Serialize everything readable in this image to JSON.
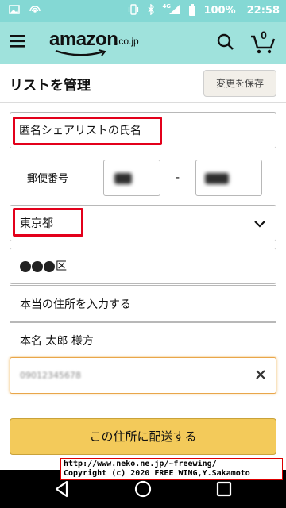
{
  "status_bar": {
    "battery_text": "100%",
    "time": "22:58",
    "network": "4G"
  },
  "header": {
    "logo_text": "amazon",
    "logo_suffix": ".co.jp",
    "cart_count": "0"
  },
  "page": {
    "title": "リストを管理",
    "save_button": "変更を保存"
  },
  "form": {
    "name_value": "匿名シェアリストの氏名",
    "postal_label": "郵便番号",
    "postal_separator": "-",
    "prefecture_value": "東京都",
    "city_suffix": "区",
    "address_value": "本当の住所を入力する",
    "recipient_value": "本名 太郎 様方",
    "phone_value": "09012345678"
  },
  "actions": {
    "deliver_button": "この住所に配送する"
  },
  "watermark": {
    "line1": "http://www.neko.ne.jp/~freewing/",
    "line2": "Copyright (c) 2020 FREE WING,Y.Sakamoto"
  },
  "colors": {
    "header_bg": "#9fe2dc",
    "status_bg": "#84d8d4",
    "highlight": "#e3001b",
    "primary_button": "#f3ca5a"
  }
}
